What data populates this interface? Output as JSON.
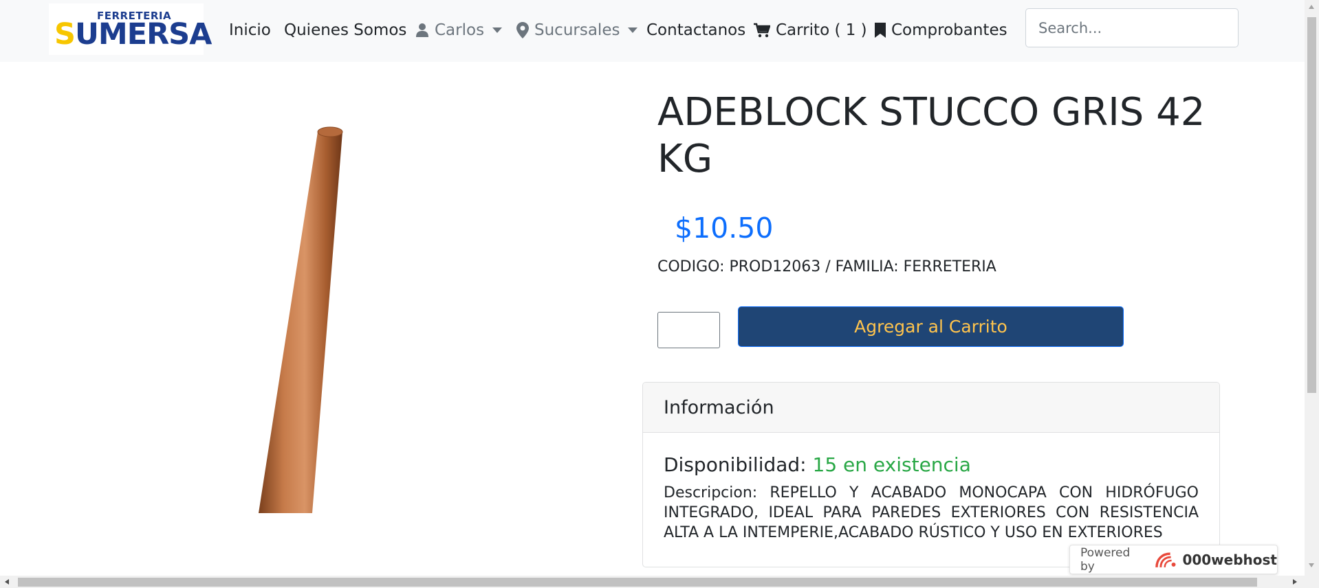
{
  "logo": {
    "small_text": "FERRETERIA",
    "big_text_first": "S",
    "big_text_rest": "UMERSA"
  },
  "nav": {
    "inicio": "Inicio",
    "quienes": "Quienes Somos",
    "user": "Carlos",
    "sucursales": "Sucursales",
    "contactanos": "Contactanos",
    "carrito": "Carrito ( 1 )",
    "comprobantes": "Comprobantes"
  },
  "search": {
    "placeholder": "Search..."
  },
  "product": {
    "title": "ADEBLOCK STUCCO GRIS 42 KG",
    "price": "$10.50",
    "code_line": "CODIGO: PROD12063 / FAMILIA: FERRETERIA",
    "quantity": "",
    "add_button": "Agregar al Carrito"
  },
  "info": {
    "header": "Información",
    "availability_label": "Disponibilidad:",
    "availability_value": "15 en existencia",
    "description": "Descripcion: REPELLO Y ACABADO MONOCAPA CON HIDRÓFUGO INTEGRADO, IDEAL PARA PAREDES EXTERIORES CON RESISTENCIA ALTA A LA INTEMPERIE,ACABADO RÚSTICO Y USO EN EXTERIORES"
  },
  "badge": {
    "powered": "Powered by",
    "brand": "000webhost"
  },
  "colors": {
    "price": "#0d6efd",
    "button_bg": "#1f4575",
    "button_text": "#ffc44d",
    "stock": "#28a745",
    "navbar_bg": "#f8f9fa"
  },
  "icons": {
    "user": "user-icon",
    "sucursales": "map-pin-icon",
    "carrito": "cart-icon",
    "comprobantes": "bookmark-icon"
  }
}
